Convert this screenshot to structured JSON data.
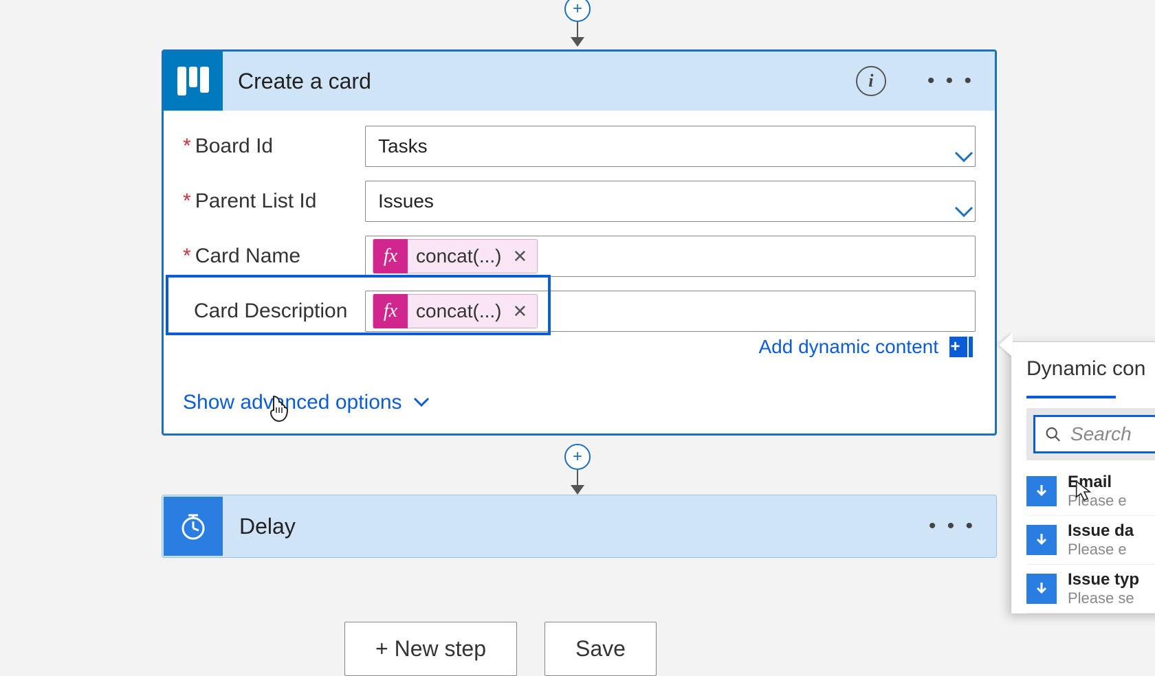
{
  "connector": {
    "plus": "+"
  },
  "card": {
    "title": "Create a card",
    "fields": {
      "boardId": {
        "label": "Board Id",
        "value": "Tasks",
        "required": true
      },
      "parentListId": {
        "label": "Parent List Id",
        "value": "Issues",
        "required": true
      },
      "cardName": {
        "label": "Card Name",
        "token": "concat(...)",
        "required": true
      },
      "cardDescription": {
        "label": "Card Description",
        "token": "concat(...)",
        "required": false
      }
    },
    "addDynamic": "Add dynamic content",
    "showAdvanced": "Show advanced options"
  },
  "delay": {
    "title": "Delay"
  },
  "buttons": {
    "newStep": "+ New step",
    "save": "Save"
  },
  "dynamic": {
    "title": "Dynamic con",
    "searchPlaceholder": "Search",
    "items": [
      {
        "title": "Email",
        "sub": "Please e"
      },
      {
        "title": "Issue da",
        "sub": "Please e"
      },
      {
        "title": "Issue typ",
        "sub": "Please se"
      }
    ]
  },
  "fx": "fx"
}
